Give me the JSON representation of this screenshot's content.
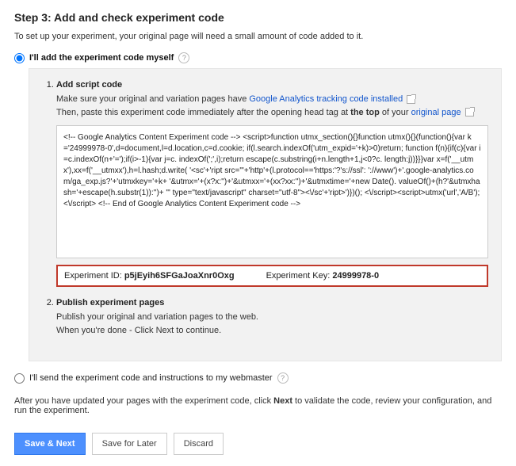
{
  "step_title": "Step 3: Add and check experiment code",
  "intro": "To set up your experiment, your original page will need a small amount of code added to it.",
  "options": {
    "self": {
      "label": "I'll add the experiment code myself"
    },
    "webmaster": {
      "label": "I'll send the experiment code and instructions to my webmaster"
    }
  },
  "panel": {
    "step1": {
      "title": "Add script code",
      "line1_pre": "Make sure your original and variation pages have ",
      "line1_link": "Google Analytics tracking code installed",
      "line2_pre": "Then, paste this experiment code immediately after the opening head tag at ",
      "line2_bold": "the top",
      "line2_post": " of your ",
      "line2_link": "original page",
      "code": "<!-- Google Analytics Content Experiment code -->\n<script>function utmx_section(){}function utmx(){}(function(){var\nk='24999978-0',d=document,l=d.location,c=d.cookie;\nif(l.search.indexOf('utm_expid='+k)>0)return;\nfunction f(n){if(c){var i=c.indexOf(n+'=');if(i>-1){var j=c.\nindexOf(';',i);return escape(c.substring(i+n.length+1,j<0?c.\nlength:j))}}}var x=f('__utmx'),xx=f('__utmxx'),h=l.hash;d.write(\n'<sc'+'ript src=\"'+'http'+(l.protocol=='https:'?'s://ssl':\n'://www')+'.google-analytics.com/ga_exp.js?'+'utmxkey='+k+\n'&utmx='+(x?x:'')+'&utmxx='+(xx?xx:'')+'&utmxtime='+new Date().\nvalueOf()+(h?'&utmxhash='+escape(h.substr(1)):'')+\n'\" type=\"text/javascript\" charset=\"utf-8\"><\\/sc'+'ript>')})();\n<\\/script><script>utmx('url','A/B');<\\/script>\n<!-- End of Google Analytics Content Experiment code -->",
      "exp_id_label": "Experiment ID:",
      "exp_id_value": "p5jEyih6SFGaJoaXnr0Oxg",
      "exp_key_label": "Experiment Key:",
      "exp_key_value": "24999978-0"
    },
    "step2": {
      "title": "Publish experiment pages",
      "desc": "Publish your original and variation pages to the web.\nWhen you're done - Click Next to continue."
    }
  },
  "after": {
    "pre": "After you have updated your pages with the experiment code, click ",
    "bold": "Next",
    "post": " to validate the code, review your configuration, and run the experiment."
  },
  "buttons": {
    "save_next": "Save & Next",
    "save_later": "Save for Later",
    "discard": "Discard"
  }
}
